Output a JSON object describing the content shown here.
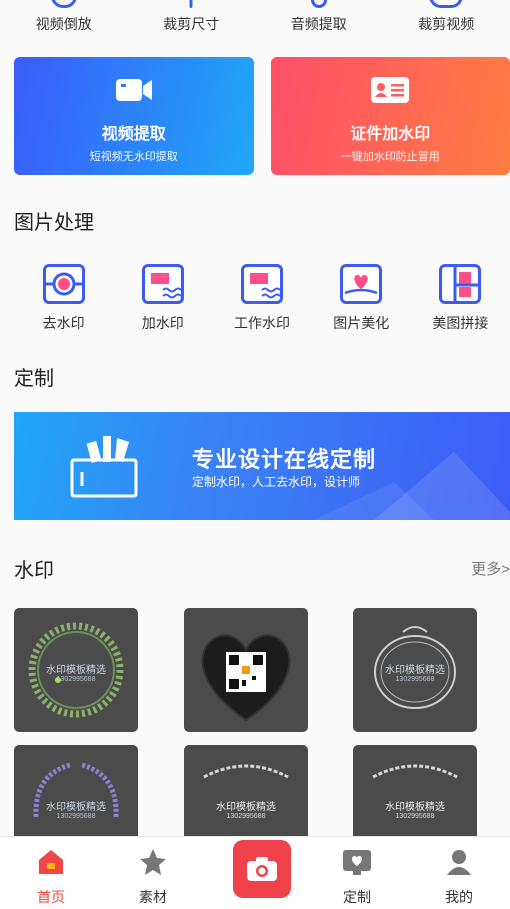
{
  "top_tools": [
    {
      "label": "视频倒放",
      "icon": "reverse-icon"
    },
    {
      "label": "裁剪尺寸",
      "icon": "resize-icon"
    },
    {
      "label": "音频提取",
      "icon": "audio-icon"
    },
    {
      "label": "裁剪视频",
      "icon": "scissors-icon"
    }
  ],
  "feature_cards": [
    {
      "title": "视频提取",
      "subtitle": "短视频无水印提取",
      "icon": "video-camera-icon"
    },
    {
      "title": "证件加水印",
      "subtitle": "一键加水印防止冒用",
      "icon": "id-card-icon"
    }
  ],
  "sections": {
    "image_processing": "图片处理",
    "custom": "定制",
    "watermark": "水印",
    "more": "更多>"
  },
  "image_tools": [
    {
      "label": "去水印",
      "icon": "remove-watermark-icon"
    },
    {
      "label": "加水印",
      "icon": "add-watermark-icon"
    },
    {
      "label": "工作水印",
      "icon": "work-watermark-icon"
    },
    {
      "label": "图片美化",
      "icon": "beautify-icon"
    },
    {
      "label": "美图拼接",
      "icon": "collage-icon"
    }
  ],
  "banner": {
    "title": "专业设计在线定制",
    "subtitle": "定制水印，人工去水印，设计师"
  },
  "watermarks": [
    {
      "text": "水印模板精选",
      "phone": "1302995688",
      "style": "green-wreath"
    },
    {
      "text": "",
      "phone": "",
      "style": "qr-heart"
    },
    {
      "text": "水印模板精选",
      "phone": "1302995688",
      "style": "ornate-frame"
    },
    {
      "text": "水印模板精选",
      "phone": "1302995688",
      "style": "purple-wreath"
    },
    {
      "text": "水印模板精选",
      "phone": "1302995688",
      "style": "floral-arc"
    },
    {
      "text": "水印模板精选",
      "phone": "1302995688",
      "style": "floral-arc"
    }
  ],
  "bottom_nav": [
    {
      "label": "首页",
      "icon": "home-icon",
      "active": true
    },
    {
      "label": "素材",
      "icon": "star-icon",
      "active": false
    },
    {
      "label": "",
      "icon": "camera-icon",
      "active": false
    },
    {
      "label": "定制",
      "icon": "monitor-heart-icon",
      "active": false
    },
    {
      "label": "我的",
      "icon": "user-icon",
      "active": false
    }
  ],
  "colors": {
    "primary_blue": "#3b5bf5",
    "accent_red": "#f04645",
    "pink": "#ff4e88"
  }
}
